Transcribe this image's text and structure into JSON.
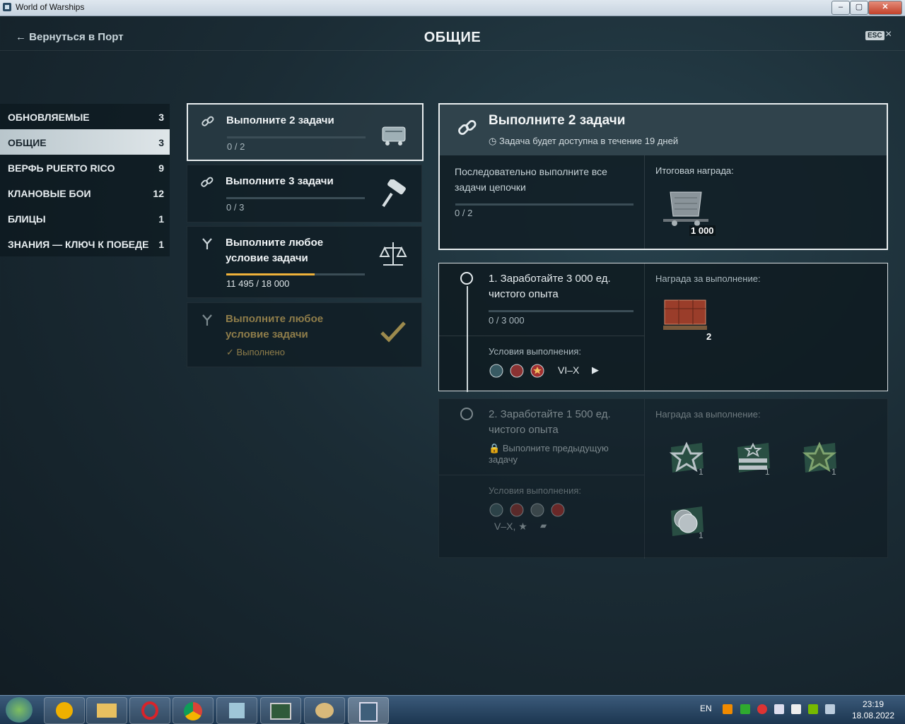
{
  "window": {
    "title": "World of Warships"
  },
  "header": {
    "back_label": "← Вернуться в Порт",
    "title": "ОБЩИЕ",
    "esc_label": "ESC",
    "close_glyph": "×"
  },
  "sidebar": {
    "items": [
      {
        "label": "ОБНОВЛЯЕМЫЕ",
        "count": "3"
      },
      {
        "label": "ОБЩИЕ",
        "count": "3"
      },
      {
        "label": "ВЕРФЬ PUERTO RICO",
        "count": "9"
      },
      {
        "label": "КЛАНОВЫЕ БОИ",
        "count": "12"
      },
      {
        "label": "БЛИЦЫ",
        "count": "1"
      },
      {
        "label": "ЗНАНИЯ — КЛЮЧ К ПОБЕДЕ",
        "count": "1"
      }
    ]
  },
  "quests": [
    {
      "title": "Выполните 2 задачи",
      "progress": "0 / 2",
      "progress_fraction": 0,
      "icon": "chain-icon",
      "image": "railcar-icon"
    },
    {
      "title": "Выполните 3 задачи",
      "progress": "0 / 3",
      "progress_fraction": 0,
      "icon": "chain-icon",
      "image": "paint-roller-icon"
    },
    {
      "title": "Выполните любое условие задачи",
      "progress": "11 495 / 18 000",
      "progress_fraction": 0.6386,
      "icon": "fork-icon",
      "image": "scales-icon"
    },
    {
      "title": "Выполните любое условие задачи",
      "status": "Выполнено",
      "icon": "fork-icon",
      "image": "checkmark-icon"
    }
  ],
  "detail": {
    "title": "Выполните 2 задачи",
    "availability": "Задача будет доступна в течение 19 дней",
    "description": "Последовательно выполните все задачи цепочки",
    "progress": "0 / 2",
    "final_reward_label": "Итоговая награда:",
    "final_reward_amount": "1 000",
    "tasks": [
      {
        "title": "1. Заработайте 3 000 ед. чистого опыта",
        "progress": "0 / 3 000",
        "conditions_label": "Условия выполнения:",
        "tier": "VI–X",
        "reward_label": "Награда за выполнение:",
        "reward_count": "2"
      },
      {
        "title": "2. Заработайте 1 500 ед. чистого опыта",
        "locked_text": "Выполните предыдущую задачу",
        "conditions_label": "Условия выполнения:",
        "tier": "V–X, ★",
        "reward_label": "Награда за выполнение:",
        "reward_counts": [
          "1",
          "1",
          "1",
          "1"
        ]
      }
    ]
  },
  "taskbar": {
    "lang": "EN",
    "time": "23:19",
    "date": "18.08.2022"
  }
}
